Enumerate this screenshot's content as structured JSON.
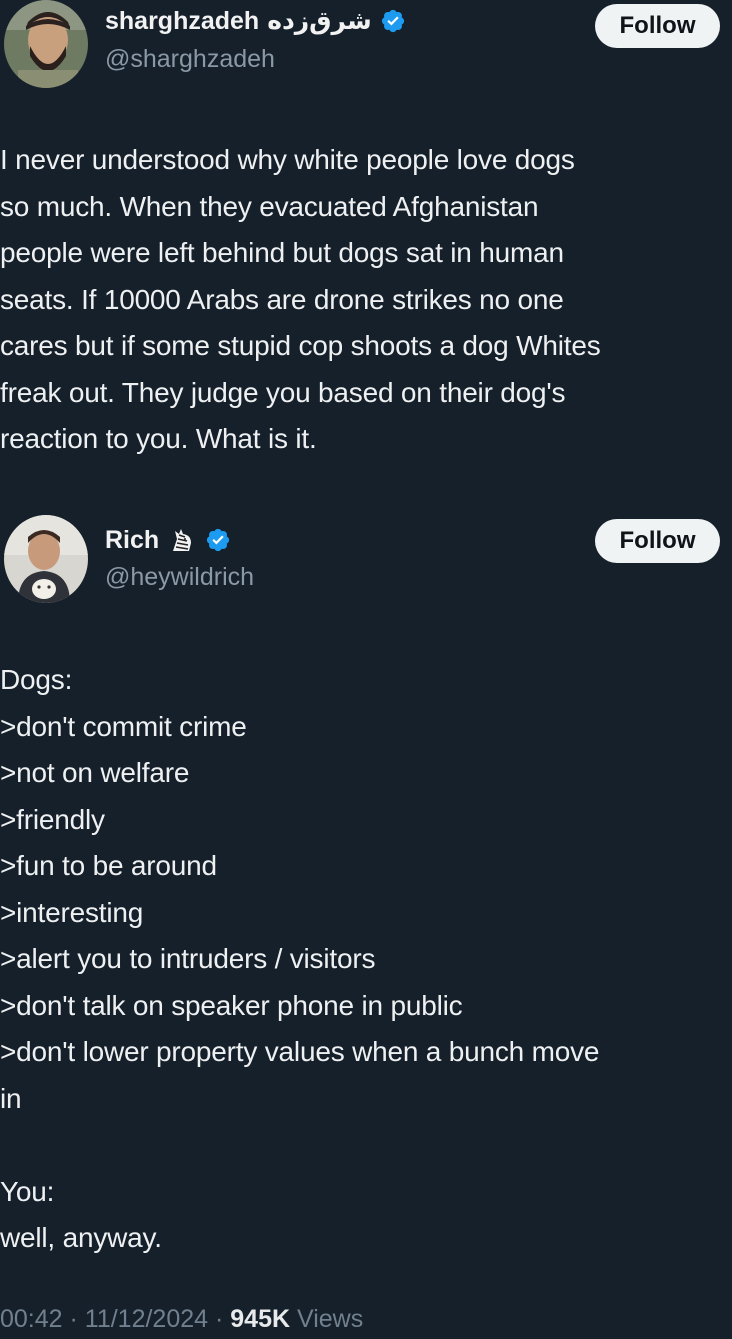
{
  "tweets": [
    {
      "display_name": "sharghzadeh",
      "display_name_alt": "شرق‌زده",
      "handle": "@sharghzadeh",
      "follow_label": "Follow",
      "text": "I never understood why white people love dogs\nso much. When they evacuated Afghanistan\npeople were left behind but dogs sat in human\nseats. If 10000 Arabs are drone strikes no one\ncares but if some stupid cop shoots a dog Whites\nfreak out. They judge you based on their dog's\nreaction to you. What is it."
    },
    {
      "display_name": "Rich",
      "handle": "@heywildrich",
      "follow_label": "Follow",
      "emoji_icon": "zebra-icon",
      "text": "Dogs:\n>don't commit crime\n>not on welfare\n>friendly\n>fun to be around\n>interesting\n>alert you to intruders / visitors\n>don't talk on speaker phone in public\n>don't lower property values when a bunch move\nin\n\nYou:\nwell, anyway."
    }
  ],
  "meta": {
    "time": "00:42",
    "separator": " · ",
    "date": "11/12/2024",
    "views_count": "945K",
    "views_label": " Views"
  },
  "colors": {
    "background": "#15202b",
    "verified": "#1d9bf0",
    "follow_bg": "#eff3f4",
    "secondary_text": "#8b98a5"
  }
}
